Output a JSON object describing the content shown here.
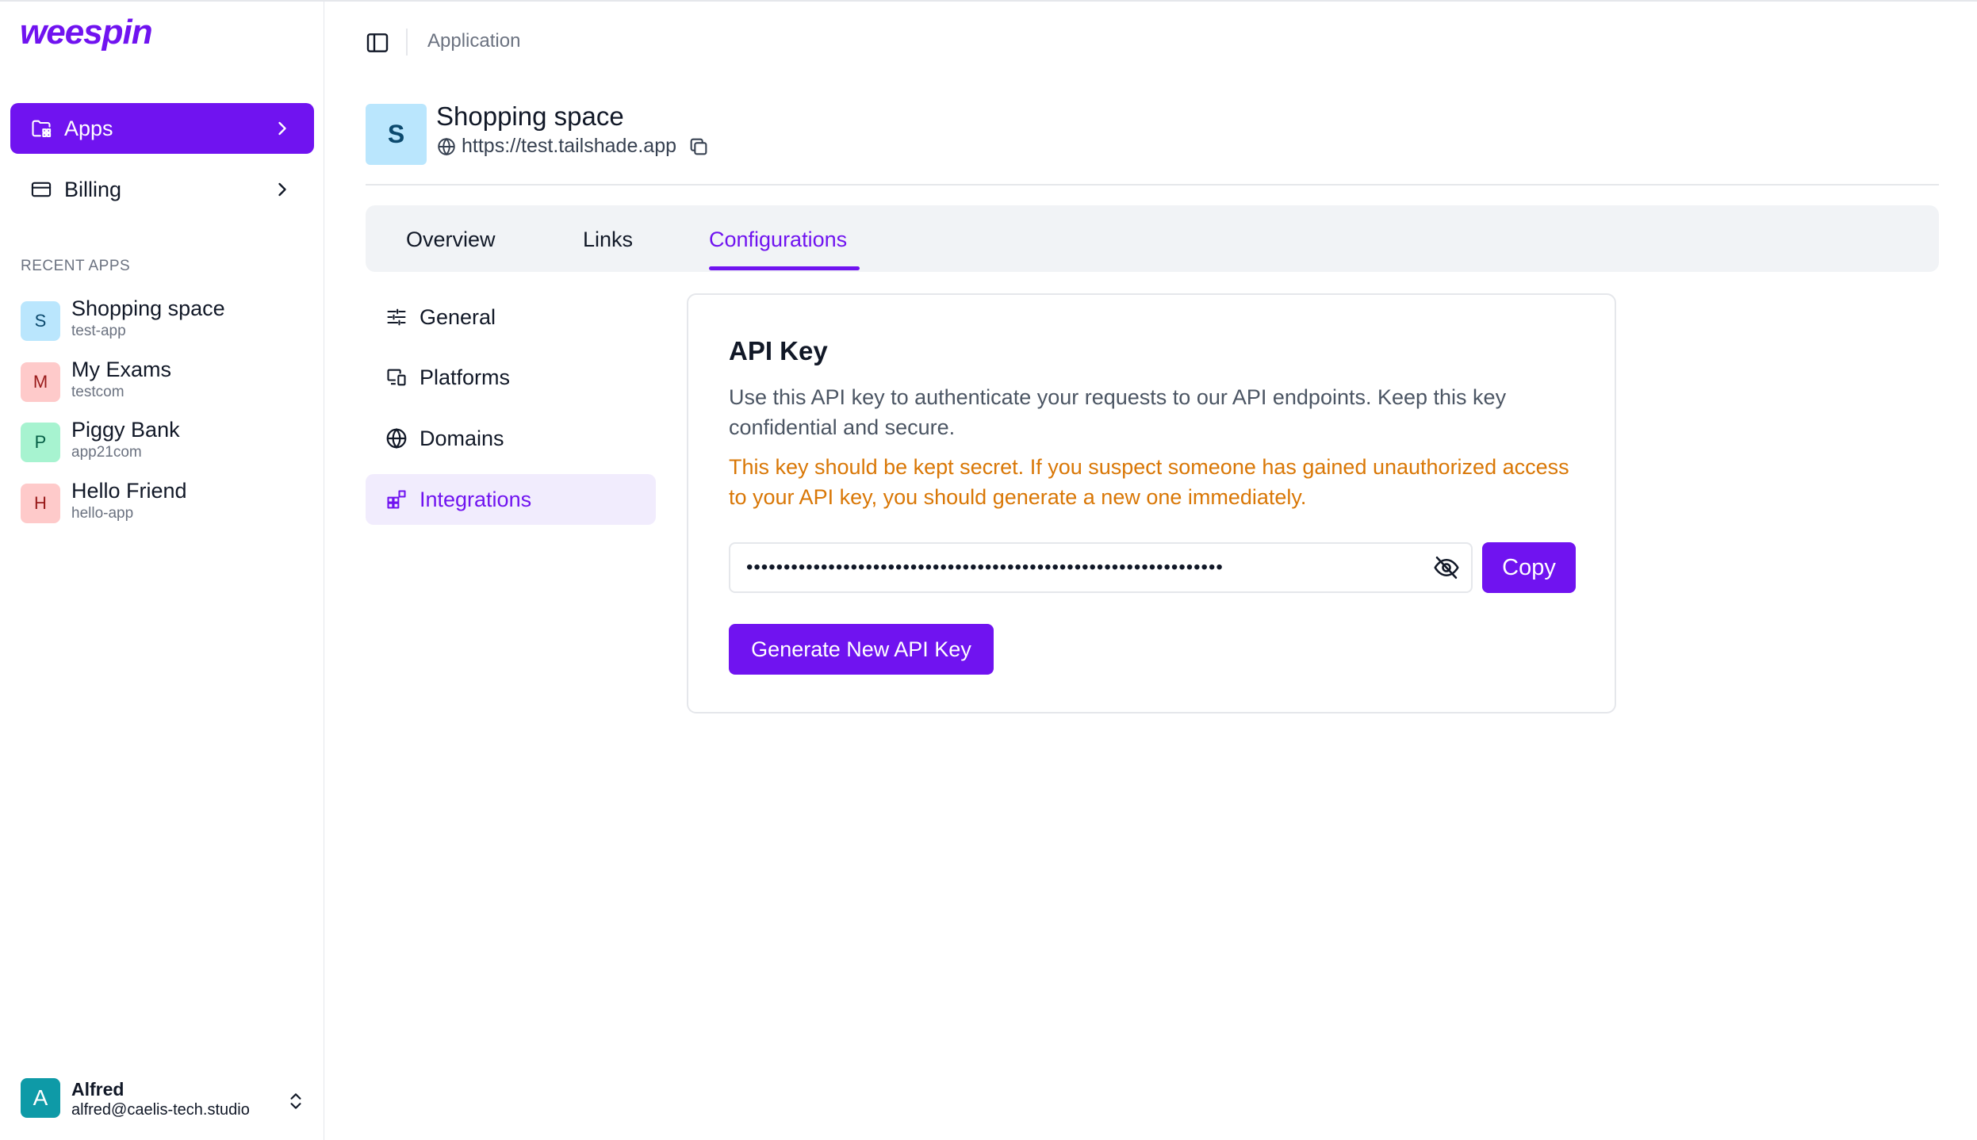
{
  "brand": {
    "logo_text": "weespin",
    "accent": "#7013f0"
  },
  "sidebar": {
    "nav": [
      {
        "label": "Apps",
        "icon": "folder-apps-icon",
        "active": true
      },
      {
        "label": "Billing",
        "icon": "credit-card-icon",
        "active": false
      }
    ],
    "recent_label": "RECENT APPS",
    "recent_apps": [
      {
        "initial": "S",
        "name": "Shopping space",
        "slug": "test-app",
        "color": "#bae6fd"
      },
      {
        "initial": "M",
        "name": "My Exams",
        "slug": "testcom",
        "color": "#fecaca"
      },
      {
        "initial": "P",
        "name": "Piggy Bank",
        "slug": "app21com",
        "color": "#a7f3d0"
      },
      {
        "initial": "H",
        "name": "Hello Friend",
        "slug": "hello-app",
        "color": "#fecaca"
      }
    ],
    "user": {
      "initial": "A",
      "name": "Alfred",
      "email": "alfred@caelis-tech.studio"
    }
  },
  "header": {
    "breadcrumb": "Application"
  },
  "app": {
    "initial": "S",
    "title": "Shopping space",
    "url": "https://test.tailshade.app"
  },
  "tabs": [
    {
      "label": "Overview",
      "active": false
    },
    {
      "label": "Links",
      "active": false
    },
    {
      "label": "Configurations",
      "active": true
    }
  ],
  "config_menu": [
    {
      "label": "General",
      "icon": "sliders-icon",
      "active": false
    },
    {
      "label": "Platforms",
      "icon": "devices-icon",
      "active": false
    },
    {
      "label": "Domains",
      "icon": "globe-icon",
      "active": false
    },
    {
      "label": "Integrations",
      "icon": "integrations-icon",
      "active": true
    }
  ],
  "api_key": {
    "title": "API Key",
    "description": "Use this API key to authenticate your requests to our API endpoints. Keep this key confidential and secure.",
    "warning": "This key should be kept secret. If you suspect someone has gained unauthorized access to your API key, you should generate a new one immediately.",
    "masked_value": "••••••••••••••••••••••••••••••••••••••••••••••••••••••••••••••••",
    "copy_label": "Copy",
    "generate_label": "Generate New API Key"
  }
}
